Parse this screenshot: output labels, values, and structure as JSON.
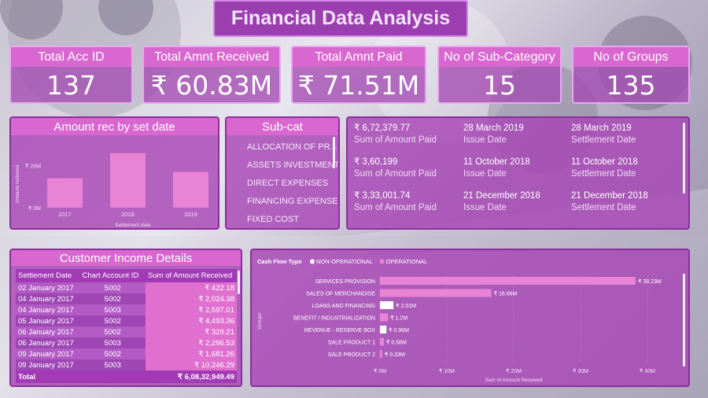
{
  "header": {
    "title": "Financial Data Analysis"
  },
  "kpis": [
    {
      "label": "Total Acc ID",
      "value": "137"
    },
    {
      "label": "Total Amnt Received",
      "value": "₹ 60.83M"
    },
    {
      "label": "Total Amnt Paid",
      "value": "₹ 71.51M"
    },
    {
      "label": "No of Sub-Category",
      "value": "15"
    },
    {
      "label": "No of Groups",
      "value": "135"
    }
  ],
  "amount_chart": {
    "title": "Amount rec by set date",
    "chart_data": {
      "type": "bar",
      "categories": [
        "2017",
        "2018",
        "2019"
      ],
      "values": [
        14,
        26,
        17
      ],
      "ylabel": "Amount recieved",
      "xlabel": "Settlement date",
      "yticks": [
        "₹ 0M",
        "₹ 20M"
      ],
      "ylim": [
        0,
        30
      ],
      "color": "#e983d6"
    }
  },
  "subcat": {
    "title": "Sub-cat",
    "items": [
      "ALLOCATION OF PR...",
      "ASSETS INVESTMENTS",
      "DIRECT EXPENSES",
      "FINANCING EXPENSES",
      "FIXED COST"
    ]
  },
  "cards": [
    {
      "amount": "₹ 6,72,379.77",
      "amount_label": "Sum of Amount Paid",
      "issue": "28 March 2019",
      "issue_label": "Issue Date",
      "settle": "28 March 2019",
      "settle_label": "Settlement Date"
    },
    {
      "amount": "₹ 3,60,199",
      "amount_label": "Sum of Amount Paid",
      "issue": "11 October 2018",
      "issue_label": "Issue Date",
      "settle": "11 October 2018",
      "settle_label": "Settlement Date"
    },
    {
      "amount": "₹ 3,33,001.74",
      "amount_label": "Sum of Amount Paid",
      "issue": "21 December 2018",
      "issue_label": "Issue Date",
      "settle": "21 December 2018",
      "settle_label": "Settlement Date"
    }
  ],
  "customer_income": {
    "title": "Customer Income Details",
    "columns": [
      "Settlement Date",
      "Chart Account ID",
      "Sum of Amount Received"
    ],
    "rows": [
      [
        "02 January 2017",
        "5002",
        "₹ 422.18"
      ],
      [
        "04 January 2017",
        "5002",
        "₹ 2,024.38"
      ],
      [
        "04 January 2017",
        "5003",
        "₹ 2,597.01"
      ],
      [
        "05 January 2017",
        "5002",
        "₹ 4,493.36"
      ],
      [
        "06 January 2017",
        "5002",
        "₹ 329.21"
      ],
      [
        "06 January 2017",
        "5003",
        "₹ 2,296.53"
      ],
      [
        "09 January 2017",
        "5002",
        "₹ 1,681.26"
      ],
      [
        "09 January 2017",
        "5003",
        "₹ 10,246.29"
      ]
    ],
    "total_label": "Total",
    "total_value": "₹ 6,08,32,949.49"
  },
  "cashflow": {
    "legend_title": "Cash Flow Type",
    "legend": [
      {
        "name": "NON-OPERATIONAL",
        "color": "#ffffff"
      },
      {
        "name": "OPERATIONAL",
        "color": "#e983d6"
      }
    ],
    "chart_data": {
      "type": "bar",
      "orientation": "horizontal",
      "categories": [
        "SERVICES PROVISION",
        "SALES OF MERCHANDISE",
        "LOANS AND FINANCING",
        "BENEFIT / INDUSTRIALIZATION",
        "REVENUE - RESERVE BOX",
        "SALE PRODUCT 1",
        "SALE PRODUCT 2"
      ],
      "values": [
        38.23,
        16.66,
        2.01,
        1.2,
        0.96,
        0.58,
        0.33
      ],
      "labels": [
        "₹ 38.23M",
        "₹ 16.66M",
        "₹ 2.01M",
        "₹ 1.2M",
        "₹ 0.96M",
        "₹ 0.58M",
        "₹ 0.33M"
      ],
      "types": [
        "OPERATIONAL",
        "OPERATIONAL",
        "NON-OPERATIONAL",
        "OPERATIONAL",
        "NON-OPERATIONAL",
        "OPERATIONAL",
        "OPERATIONAL"
      ],
      "xticks": [
        "₹ 0M",
        "₹ 10M",
        "₹ 20M",
        "₹ 30M",
        "₹ 40M"
      ],
      "xlim": [
        0,
        40
      ],
      "xlabel": "Sum of Amount Received",
      "ylabel": "Groups"
    }
  }
}
